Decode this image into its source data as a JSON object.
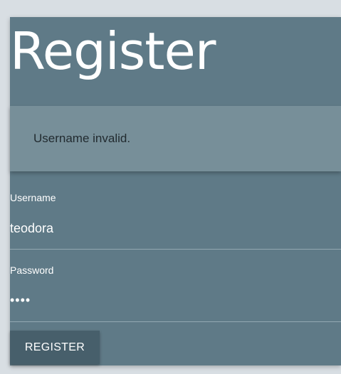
{
  "form": {
    "title": "Register",
    "alert_message": "Username invalid.",
    "username": {
      "label": "Username",
      "value": "teodora"
    },
    "password": {
      "label": "Password",
      "value": "••••"
    },
    "submit_label": "REGISTER"
  },
  "colors": {
    "page_background": "#d8dee3",
    "card_background": "#5f7a87",
    "alert_background": "#778f99",
    "button_background": "#475f6b"
  }
}
